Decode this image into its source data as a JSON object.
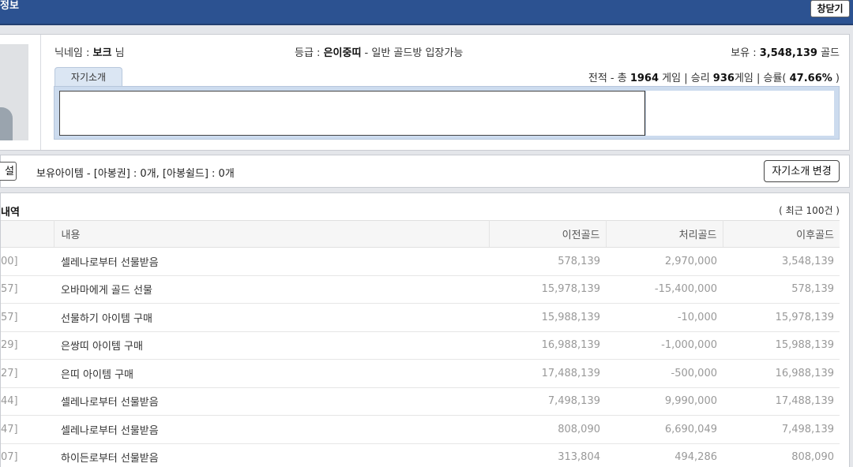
{
  "window": {
    "title": "정보",
    "close_label": "창닫기"
  },
  "profile": {
    "nickname_label": "닉네임 : ",
    "nickname": "보크",
    "nickname_suffix": " 님",
    "grade_label": "등급 : ",
    "grade": "은이중띠",
    "grade_desc": " - 일반 골드방 입장가능",
    "gold_label": "보유 : ",
    "gold": "3,548,139",
    "gold_unit": " 골드",
    "record_prefix": "전적 - 총 ",
    "record_total": "1964",
    "record_mid": " 게임 | 승리 ",
    "record_wins": "936",
    "record_mid2": "게임 | 승률( ",
    "record_rate": "47.66%",
    "record_suffix": " )",
    "intro_tab": "자기소개",
    "intro_text": ""
  },
  "items_bar": {
    "left_button": "설정",
    "items_text": "보유아이템 - [아봉권] : 0개, [아봉쉴드] : 0개",
    "change_button": "자기소개 변경"
  },
  "history": {
    "title": "내역",
    "count": "( 최근 100건 )",
    "columns": [
      "",
      "내용",
      "이전골드",
      "처리골드",
      "이후골드"
    ],
    "rows": [
      {
        "date": "00]",
        "content": "셀레나로부터 선물받음",
        "before": "578,139",
        "change": "2,970,000",
        "after": "3,548,139"
      },
      {
        "date": "57]",
        "content": "오바마에게 골드 선물",
        "before": "15,978,139",
        "change": "-15,400,000",
        "after": "578,139"
      },
      {
        "date": "57]",
        "content": "선물하기 아이템 구매",
        "before": "15,988,139",
        "change": "-10,000",
        "after": "15,978,139"
      },
      {
        "date": "29]",
        "content": "은쌍띠 아이템 구매",
        "before": "16,988,139",
        "change": "-1,000,000",
        "after": "15,988,139"
      },
      {
        "date": "27]",
        "content": "은띠 아이템 구매",
        "before": "17,488,139",
        "change": "-500,000",
        "after": "16,988,139"
      },
      {
        "date": "44]",
        "content": "셀레나로부터 선물받음",
        "before": "7,498,139",
        "change": "9,990,000",
        "after": "17,488,139"
      },
      {
        "date": "47]",
        "content": "셀레나로부터 선물받음",
        "before": "808,090",
        "change": "6,690,049",
        "after": "7,498,139"
      },
      {
        "date": "07]",
        "content": "하이든로부터 선물받음",
        "before": "313,804",
        "change": "494,286",
        "after": "808,090"
      }
    ]
  }
}
